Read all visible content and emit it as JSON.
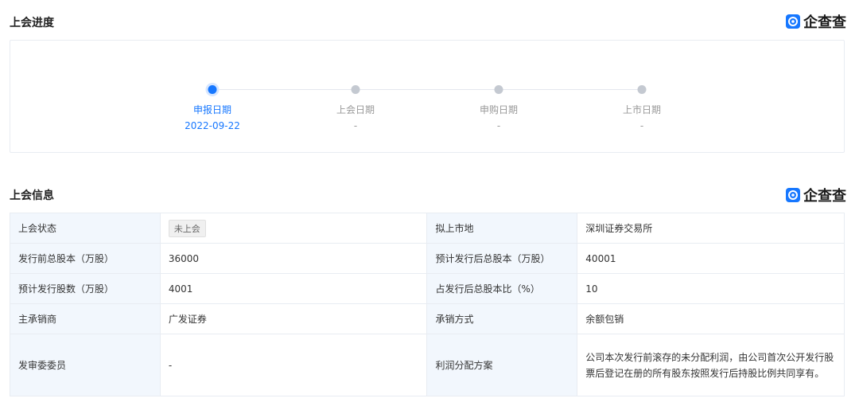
{
  "progress": {
    "title": "上会进度",
    "brand": "企查查",
    "steps": [
      {
        "label": "申报日期",
        "date": "2022-09-22"
      },
      {
        "label": "上会日期",
        "date": "-"
      },
      {
        "label": "申购日期",
        "date": "-"
      },
      {
        "label": "上市日期",
        "date": "-"
      }
    ]
  },
  "info": {
    "title": "上会信息",
    "brand": "企查查",
    "rows": [
      {
        "l1": "上会状态",
        "v1": "未上会",
        "l2": "拟上市地",
        "v2": "深圳证券交易所"
      },
      {
        "l1": "发行前总股本（万股）",
        "v1": "36000",
        "l2": "预计发行后总股本（万股）",
        "v2": "40001"
      },
      {
        "l1": "预计发行股数（万股）",
        "v1": "4001",
        "l2": "占发行后总股本比（%）",
        "v2": "10"
      },
      {
        "l1": "主承销商",
        "v1": "广发证券",
        "l2": "承销方式",
        "v2": "余额包销"
      },
      {
        "l1": "发审委委员",
        "v1": "-",
        "l2": "利润分配方案",
        "v2": "公司本次发行前滚存的未分配利润，由公司首次公开发行股票后登记在册的所有股东按照发行后持股比例共同享有。"
      }
    ]
  },
  "colors": {
    "accent": "#1677ff",
    "label_bg": "#f2f7fd"
  }
}
